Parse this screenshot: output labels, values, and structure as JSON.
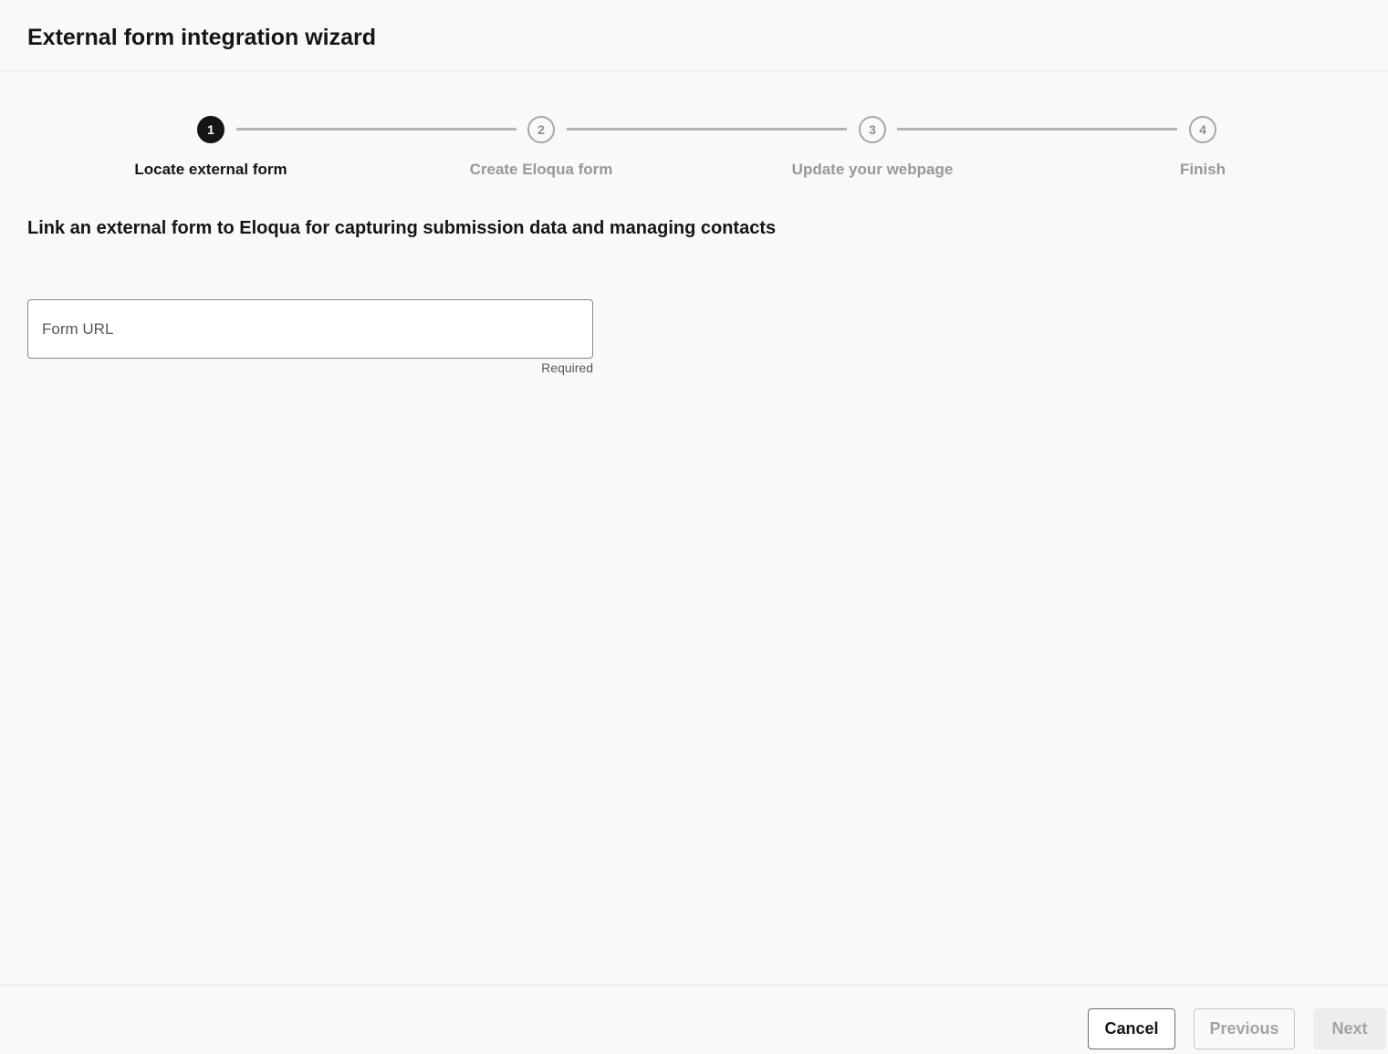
{
  "dialog": {
    "title": "External form integration wizard"
  },
  "train": {
    "steps": [
      {
        "number": "1",
        "label": "Locate external form",
        "state": "active"
      },
      {
        "number": "2",
        "label": "Create Eloqua form",
        "state": "inactive"
      },
      {
        "number": "3",
        "label": "Update your webpage",
        "state": "inactive"
      },
      {
        "number": "4",
        "label": "Finish",
        "state": "inactive"
      }
    ]
  },
  "main": {
    "subheading": "Link an external form to Eloqua for capturing submission data and managing contacts",
    "form_url": {
      "placeholder": "Form URL",
      "value": "",
      "helper": "Required"
    }
  },
  "footer": {
    "cancel_label": "Cancel",
    "previous_label": "Previous",
    "next_label": "Next"
  },
  "colors": {
    "background": "#faf9f7",
    "active_step": "#161513",
    "inactive_step": "#9a9895",
    "connector": "#b5b3b0"
  }
}
